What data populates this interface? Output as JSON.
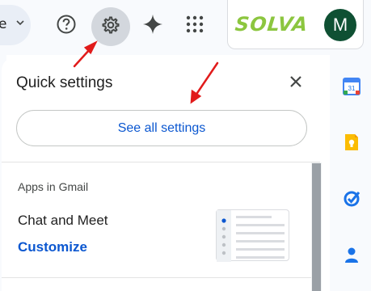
{
  "topbar": {
    "search_tail_text": "e",
    "help_icon": "help-circle-icon",
    "settings_icon": "gear-icon",
    "gemini_icon": "gemini-sparkle-icon",
    "apps_icon": "apps-grid-icon",
    "brand": "SOLVA",
    "avatar_letter": "M"
  },
  "quick_settings": {
    "title": "Quick settings",
    "close_icon": "close-icon",
    "see_all_label": "See all settings",
    "section_label": "Apps in Gmail",
    "chat_label": "Chat and Meet",
    "customize_label": "Customize"
  },
  "side_panel": {
    "calendar_day": "31",
    "icons": [
      "calendar-icon",
      "keep-icon",
      "tasks-icon",
      "contacts-icon"
    ]
  },
  "colors": {
    "accent_blue": "#0b57d0",
    "brand_green": "#8cc63f",
    "avatar_bg": "#0f5033",
    "annotation_red": "#e11b1b"
  }
}
